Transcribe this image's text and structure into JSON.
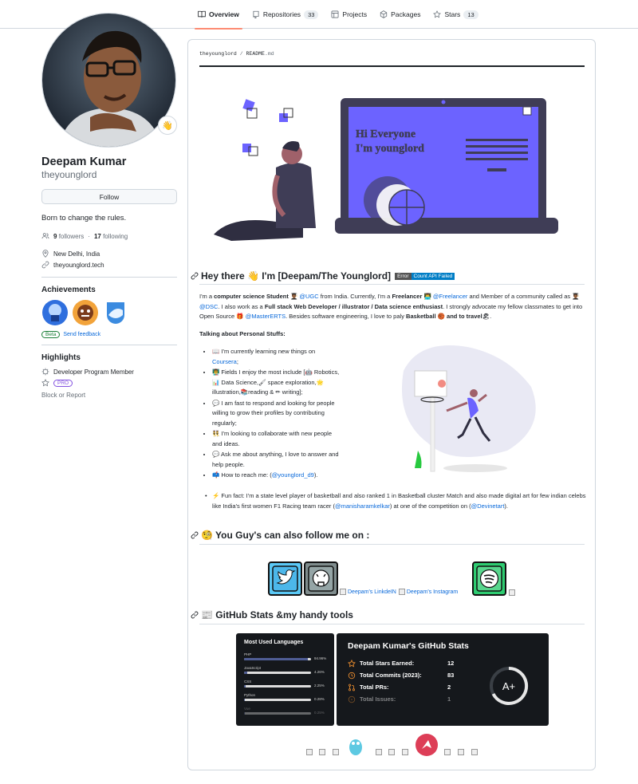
{
  "nav": {
    "tabs": [
      {
        "label": "Overview"
      },
      {
        "label": "Repositories",
        "count": "33"
      },
      {
        "label": "Projects"
      },
      {
        "label": "Packages"
      },
      {
        "label": "Stars",
        "count": "13"
      }
    ]
  },
  "profile": {
    "status_emoji": "👋",
    "name": "Deepam Kumar",
    "login": "theyounglord",
    "follow_label": "Follow",
    "bio": "Born to change the rules.",
    "followers_count": "9",
    "followers_label": "followers",
    "dot": "·",
    "following_count": "17",
    "following_label": "following",
    "location": "New Delhi, India",
    "website": "theyounglord.tech"
  },
  "achievements": {
    "title": "Achievements",
    "beta": "Beta",
    "feedback": "Send feedback"
  },
  "highlights": {
    "title": "Highlights",
    "item1": "Developer Program Member",
    "pro": "PRO",
    "block": "Block or Report"
  },
  "readme": {
    "path_user": "theyounglord",
    "path_sep": "/",
    "path_file": "README",
    "path_ext": ".md",
    "banner_line1": "Hi Everyone",
    "banner_line2": "I'm younglord",
    "hello_title": "Hey there 👋 I'm [Deepam/The Younglord]",
    "badge_left": "Error",
    "badge_right": "Count API Failed",
    "intro": {
      "p1": "I'm a ",
      "b1": "computer science Student",
      "e1": " 👨🏾‍🎓 ",
      "l1": "@UGC",
      "p2": " from India. Currently, I'm a ",
      "b2": "Freelancer",
      "e2": " 👨‍💻 ",
      "l2": "@Freelancer",
      "p3": " and Member of a community called as 👨🏾‍🎓",
      "l3": "@DSC",
      "p4": ". I also work as a ",
      "b3": "Full stack Web Developer / illustrator / Data science enthusiast",
      "p5": ". I strongly advocate my fellow classmates to get into Open Source 🎁 ",
      "l4": "@MasterERTS",
      "p6": ". Besides software engineering, I love to paly ",
      "b4": "Basketball 🏀 and to travel",
      "p7": "🏖."
    },
    "personal_title": "Talking about Personal Stuffs:",
    "list": [
      {
        "t": "📖 I'm currently learning new things on ",
        "link": "Coursera",
        "after": ";"
      },
      {
        "t": "👨‍🏫 Fields I enjoy the most include [🤖 Robotics,📊 Data Science,🖌 space exploration,🌟illustration,📚reading & ✏ writing];",
        "link": "",
        "after": ""
      },
      {
        "t": "💬 I am fast to respond and looking for people willing to grow their profiles by contributing regularly;",
        "link": "",
        "after": ""
      },
      {
        "t": "👯 I'm looking to collaborate with new people and ideas.",
        "link": "",
        "after": ""
      },
      {
        "t": "💬 Ask me about anything, I love to answer and help people.",
        "link": "",
        "after": ""
      },
      {
        "t": "📫 How to reach me: (",
        "link": "@younglord_d9",
        "after": ")."
      }
    ],
    "funfact": {
      "t": "⚡ Fun fact: I'm a state level player of basketball and also ranked 1 in Basketball cluster Match and also made digital art for few indian celebs like India's first women F1 Racing team racer (",
      "l1": "@manisharamkelkar",
      "m": ") at one of the competition on (",
      "l2": "@Devinetart",
      "end": ")."
    },
    "follow_title": "🧐 You Guy's can also follow me on :",
    "linkedin_alt": "Deepam's LinkdeIN",
    "instagram_alt": "Deepam's Instagram",
    "stats_title": "📰 GitHub Stats &my handy tools",
    "languages": {
      "title": "Most Used Languages",
      "items": [
        {
          "name": "PHP",
          "pct": "94.96%",
          "value": 94.96
        },
        {
          "name": "JavaScript",
          "pct": "4.26%",
          "value": 4.26
        },
        {
          "name": "CSS",
          "pct": "2.25%",
          "value": 2.25
        },
        {
          "name": "Python",
          "pct": "0.28%",
          "value": 0.28
        },
        {
          "name": "Vue",
          "pct": "0.25%",
          "value": 0.25
        }
      ]
    },
    "gh_stats": {
      "title": "Deepam Kumar's GitHub Stats",
      "rows": [
        {
          "label": "Total Stars Earned:",
          "value": "12",
          "icon": "star-icon"
        },
        {
          "label": "Total Commits (2023):",
          "value": "83",
          "icon": "history-icon"
        },
        {
          "label": "Total PRs:",
          "value": "2",
          "icon": "pr-icon"
        },
        {
          "label": "Total Issues:",
          "value": "1",
          "icon": "issue-icon"
        }
      ],
      "grade": "A+"
    }
  },
  "colors": {
    "accent": "#0969da",
    "tab_underline": "#fd8c73",
    "illustration_purple": "#6c63ff"
  }
}
